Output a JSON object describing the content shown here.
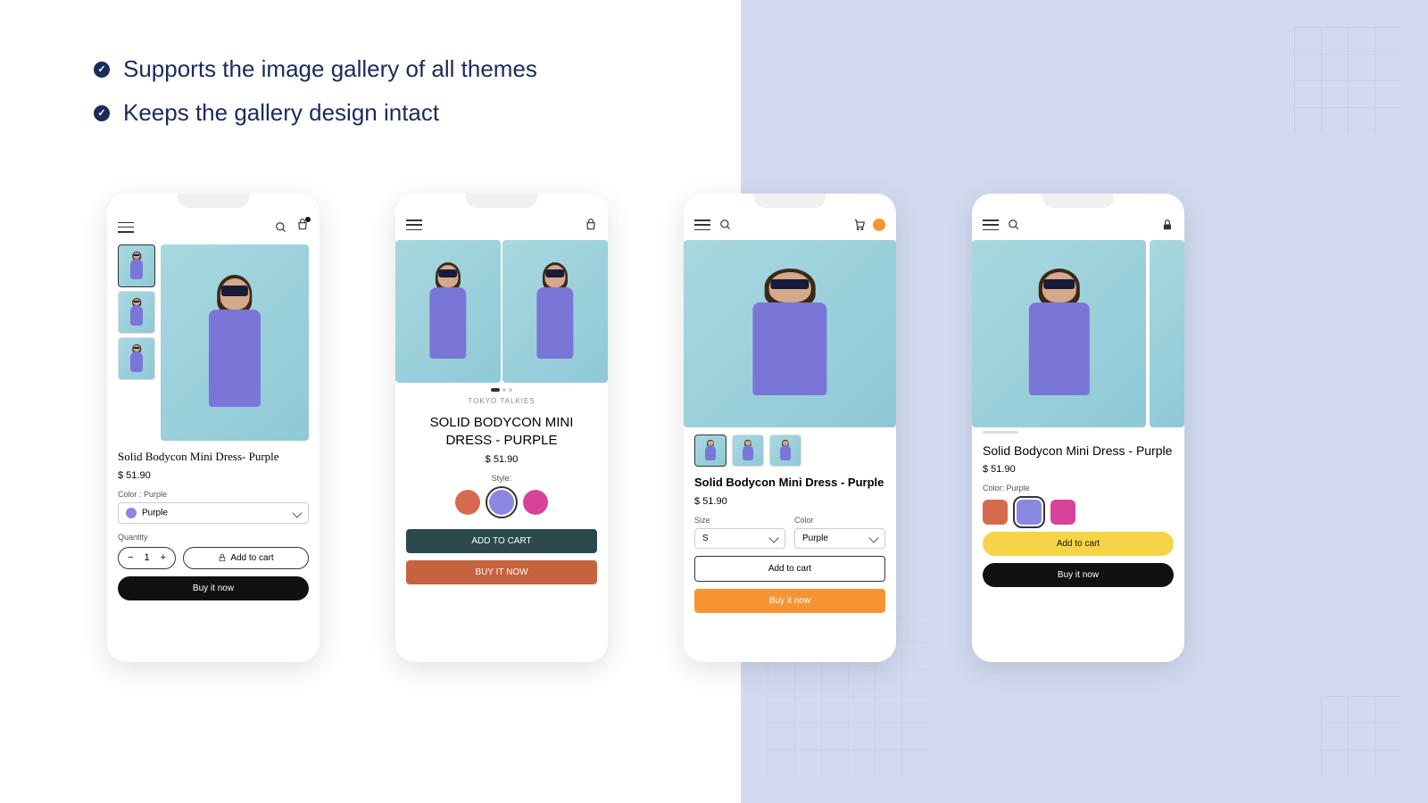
{
  "features": [
    "Supports the image gallery of all themes",
    "Keeps the gallery design intact"
  ],
  "phone1": {
    "title": "Solid Bodycon Mini Dress- Purple",
    "price": "$ 51.90",
    "color_label": "Color : Purple",
    "color_value": "Purple",
    "qty_label": "Quantity",
    "qty_value": "1",
    "add_cart": "Add to cart",
    "buy_now": "Buy it now"
  },
  "phone2": {
    "brand": "TOKYO TALKIES",
    "title": "SOLID BODYCON MINI DRESS - PURPLE",
    "price": "$ 51.90",
    "style_label": "Style:",
    "add_cart": "ADD TO CART",
    "buy_now": "BUY IT NOW",
    "swatches": [
      "#d66a4e",
      "#8a87e0",
      "#d8439a"
    ]
  },
  "phone3": {
    "title": "Solid Bodycon Mini Dress - Purple",
    "price": "$ 51.90",
    "size_label": "Size",
    "size_value": "S",
    "color_label": "Color",
    "color_value": "Purple",
    "add_cart": "Add to cart",
    "buy_now": "Buy it now"
  },
  "phone4": {
    "title": "Solid Bodycon Mini Dress - Purple",
    "price": "$ 51.90",
    "color_label": "Color: Purple",
    "add_cart": "Add to cart",
    "buy_now": "Buy it now",
    "swatches": [
      "#d66a4e",
      "#8a87e0",
      "#d8439a"
    ]
  }
}
